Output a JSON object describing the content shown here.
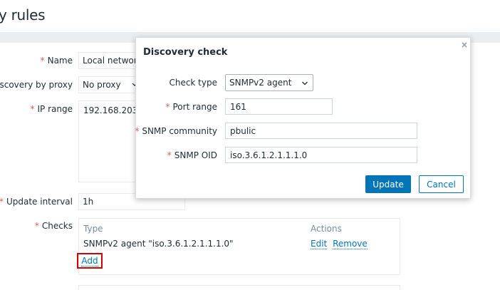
{
  "page": {
    "title": "y rules"
  },
  "form": {
    "name_label": "Name",
    "name_value": "Local network",
    "proxy_label": "Discovery by proxy",
    "proxy_value": "No proxy",
    "ip_range_label": "IP range",
    "ip_range_value": "192.168.203.",
    "update_interval_label": "Update interval",
    "update_interval_value": "1h",
    "checks_label": "Checks",
    "checks_table": {
      "col_type": "Type",
      "col_actions": "Actions",
      "rows": [
        {
          "type": "SNMPv2 agent \"iso.3.6.1.2.1.1.1.0\"",
          "edit": "Edit",
          "remove": "Remove"
        }
      ]
    },
    "add_label": "Add"
  },
  "modal": {
    "title": "Discovery check",
    "check_type_label": "Check type",
    "check_type_value": "SNMPv2 agent",
    "port_range_label": "Port range",
    "port_range_value": "161",
    "snmp_community_label": "SNMP community",
    "snmp_community_value": "pbulic",
    "snmp_oid_label": "SNMP OID",
    "snmp_oid_value": "iso.3.6.1.2.1.1.1.0",
    "update_button": "Update",
    "cancel_button": "Cancel"
  },
  "colors": {
    "accent": "#0275b8",
    "required": "#e45959",
    "highlight": "#d40000"
  },
  "icons": {
    "close": "close-icon",
    "dropdown": "chevron-down-icon"
  }
}
